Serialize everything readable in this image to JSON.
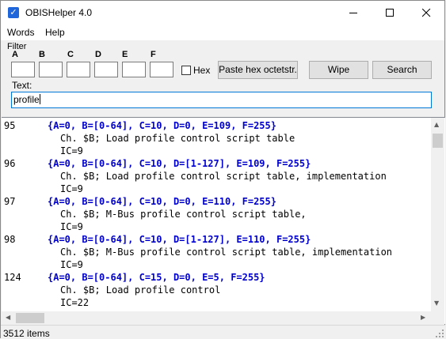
{
  "window": {
    "title": "OBISHelper 4.0"
  },
  "menu": [
    {
      "label": "Words"
    },
    {
      "label": "Help"
    }
  ],
  "filter": {
    "group_label": "Filter",
    "columns": [
      "A",
      "B",
      "C",
      "D",
      "E",
      "F"
    ],
    "hex_label": "Hex",
    "hex_checked": false,
    "buttons": {
      "paste": "Paste hex octetstr.",
      "wipe": "Wipe",
      "search": "Search"
    },
    "text_label": "Text:",
    "text_value": "profile"
  },
  "results": [
    {
      "id": "95",
      "expr": "{A=0, B=[0-64], C=10, D=0, E=109, F=255}",
      "desc": "Ch. $B; Load profile control script table",
      "ic": "IC=9"
    },
    {
      "id": "96",
      "expr": "{A=0, B=[0-64], C=10, D=[1-127], E=109, F=255}",
      "desc": "Ch. $B; Load profile control script table, implementation",
      "ic": "IC=9"
    },
    {
      "id": "97",
      "expr": "{A=0, B=[0-64], C=10, D=0, E=110, F=255}",
      "desc": "Ch. $B; M-Bus profile control script table,",
      "ic": "IC=9"
    },
    {
      "id": "98",
      "expr": "{A=0, B=[0-64], C=10, D=[1-127], E=110, F=255}",
      "desc": "Ch. $B; M-Bus profile control script table, implementation",
      "ic": "IC=9"
    },
    {
      "id": "124",
      "expr": "{A=0, B=[0-64], C=15, D=0, E=5, F=255}",
      "desc": "Ch. $B; Load profile control",
      "ic": "IC=22"
    }
  ],
  "status": {
    "count_text": "3512 items"
  }
}
